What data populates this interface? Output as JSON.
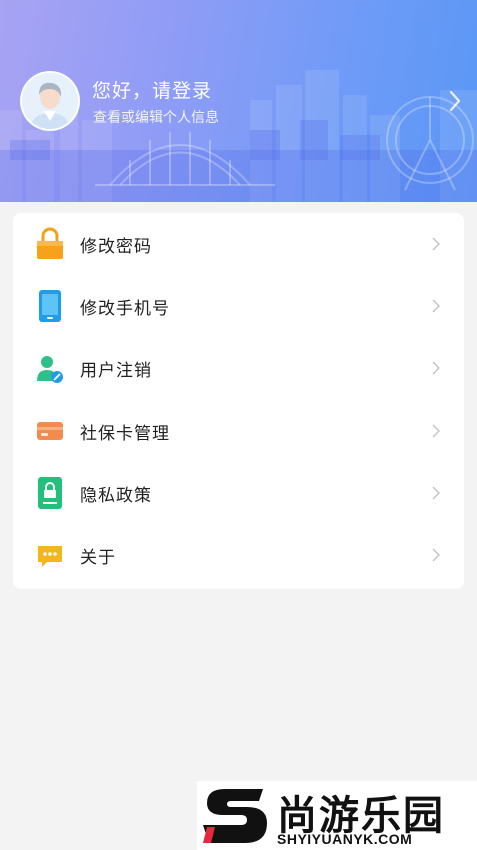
{
  "header": {
    "greeting": "您好，请登录",
    "subtitle": "查看或编辑个人信息"
  },
  "menu": {
    "items": [
      {
        "label": "修改密码",
        "icon": "lock-icon"
      },
      {
        "label": "修改手机号",
        "icon": "phone-icon"
      },
      {
        "label": "用户注销",
        "icon": "user-cancel-icon"
      },
      {
        "label": "社保卡管理",
        "icon": "social-security-card-icon"
      },
      {
        "label": "隐私政策",
        "icon": "privacy-policy-icon"
      },
      {
        "label": "关于",
        "icon": "about-chat-icon"
      }
    ]
  },
  "watermark": {
    "brand_cn": "尚游乐园",
    "brand_en": "SHYIYUANYK.COM"
  },
  "colors": {
    "header_gradient_start": "#a8a3f3",
    "header_gradient_end": "#5a97f6",
    "background": "#f3f3f3",
    "card": "#ffffff"
  }
}
